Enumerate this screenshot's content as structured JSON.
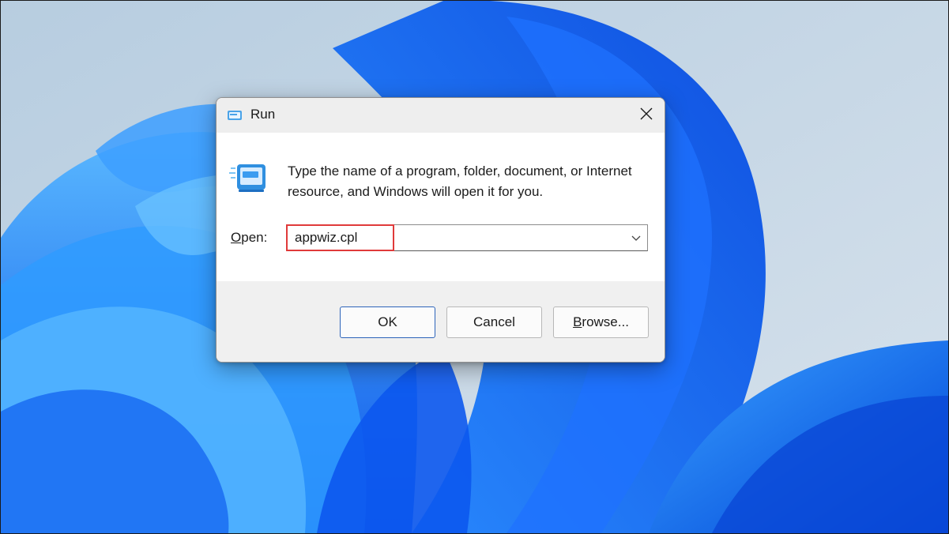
{
  "dialog": {
    "title": "Run",
    "title_icon": "run-icon",
    "close_icon": "close-icon",
    "description": "Type the name of a program, folder, document, or Internet resource, and Windows will open it for you.",
    "open_label_mnemonic": "O",
    "open_label_rest": "pen:",
    "input_value": "appwiz.cpl",
    "dropdown_icon": "chevron-down-icon",
    "buttons": {
      "ok": "OK",
      "cancel": "Cancel",
      "browse_mnemonic": "B",
      "browse_rest": "rowse..."
    }
  },
  "colors": {
    "accent": "#2b62b8",
    "highlight": "#e03a3a",
    "wallpaper_blue": "#0a5cf0"
  }
}
